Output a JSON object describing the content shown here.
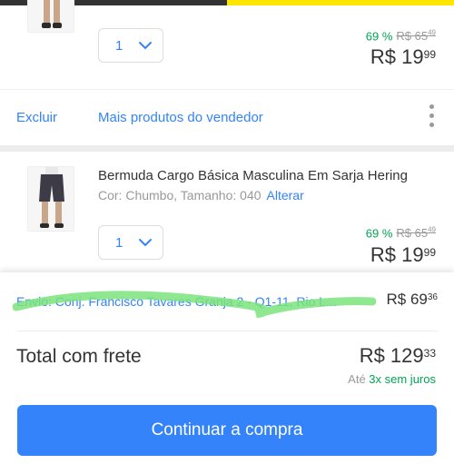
{
  "colors": {
    "accent": "#3483fa",
    "green": "#00a650",
    "yellow": "#ffe600"
  },
  "items": [
    {
      "quantity": "1",
      "discount": "69 %",
      "old_price_int": "R$ 65",
      "old_price_cents": "49",
      "price_int": "R$ 19",
      "price_cents": "99"
    },
    {
      "title": "Bermuda Cargo Básica Masculina Em Sarja Hering",
      "meta": "Cor: Chumbo, Tamanho: 040",
      "alter_label": "Alterar",
      "quantity": "1",
      "discount": "69 %",
      "old_price_int": "R$ 65",
      "old_price_cents": "49",
      "price_int": "R$ 19",
      "price_cents": "99"
    }
  ],
  "actions": {
    "delete_label": "Excluir",
    "more_products_label": "Mais produtos do vendedor"
  },
  "shipping": {
    "text": "Envio: Conj. Francisco Tavares Granja 2 - Q1-11, Rio L...",
    "price_int": "R$ 69",
    "price_cents": "36"
  },
  "total": {
    "label": "Total com frete",
    "price_int": "R$ 129",
    "price_cents": "33",
    "installments_prefix": "Até",
    "installments_value": "3x sem juros"
  },
  "cta_label": "Continuar a compra"
}
